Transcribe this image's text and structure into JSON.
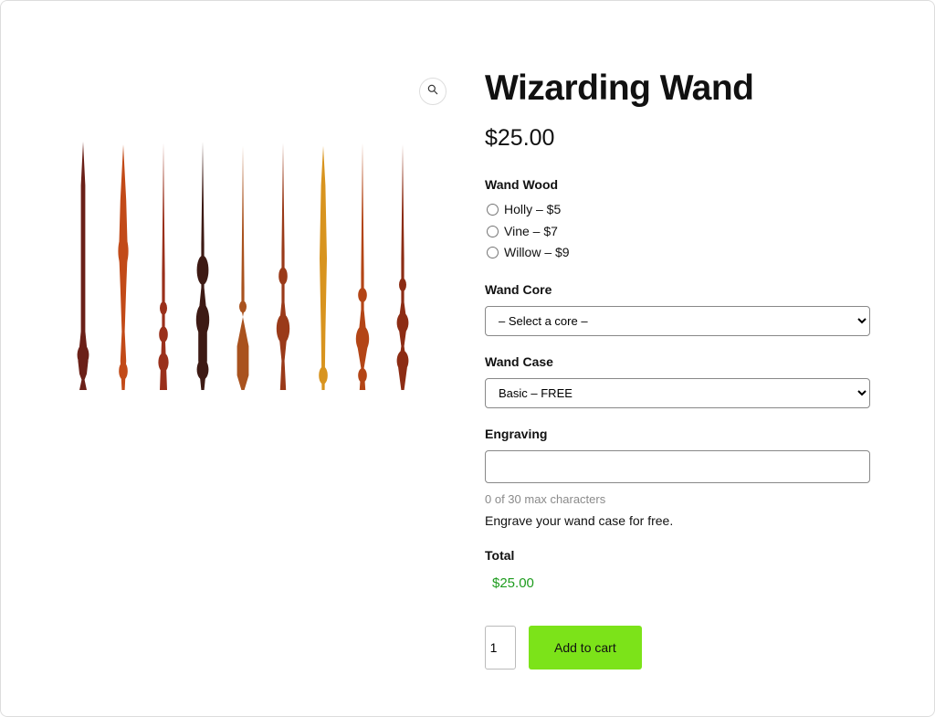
{
  "product": {
    "title": "Wizarding Wand",
    "price": "$25.00"
  },
  "wood": {
    "label": "Wand Wood",
    "options": [
      "Holly – $5",
      "Vine – $7",
      "Willow – $9"
    ]
  },
  "core": {
    "label": "Wand Core",
    "selected": "– Select a core –"
  },
  "case": {
    "label": "Wand Case",
    "selected": "Basic – FREE"
  },
  "engraving": {
    "label": "Engraving",
    "value": "",
    "char_count": "0 of 30 max characters",
    "note": "Engrave your wand case for free."
  },
  "total": {
    "label": "Total",
    "value": "$25.00"
  },
  "cart": {
    "qty": "1",
    "add_label": "Add to cart"
  },
  "colors": {
    "accent_button": "#7CE319",
    "total_text": "#1e9c1e"
  },
  "wands_palette": [
    "#6b2018",
    "#c24a18",
    "#9a301b",
    "#3d1a14",
    "#a9521e",
    "#9a3a19",
    "#d8941f",
    "#b34516",
    "#8c2c14"
  ]
}
